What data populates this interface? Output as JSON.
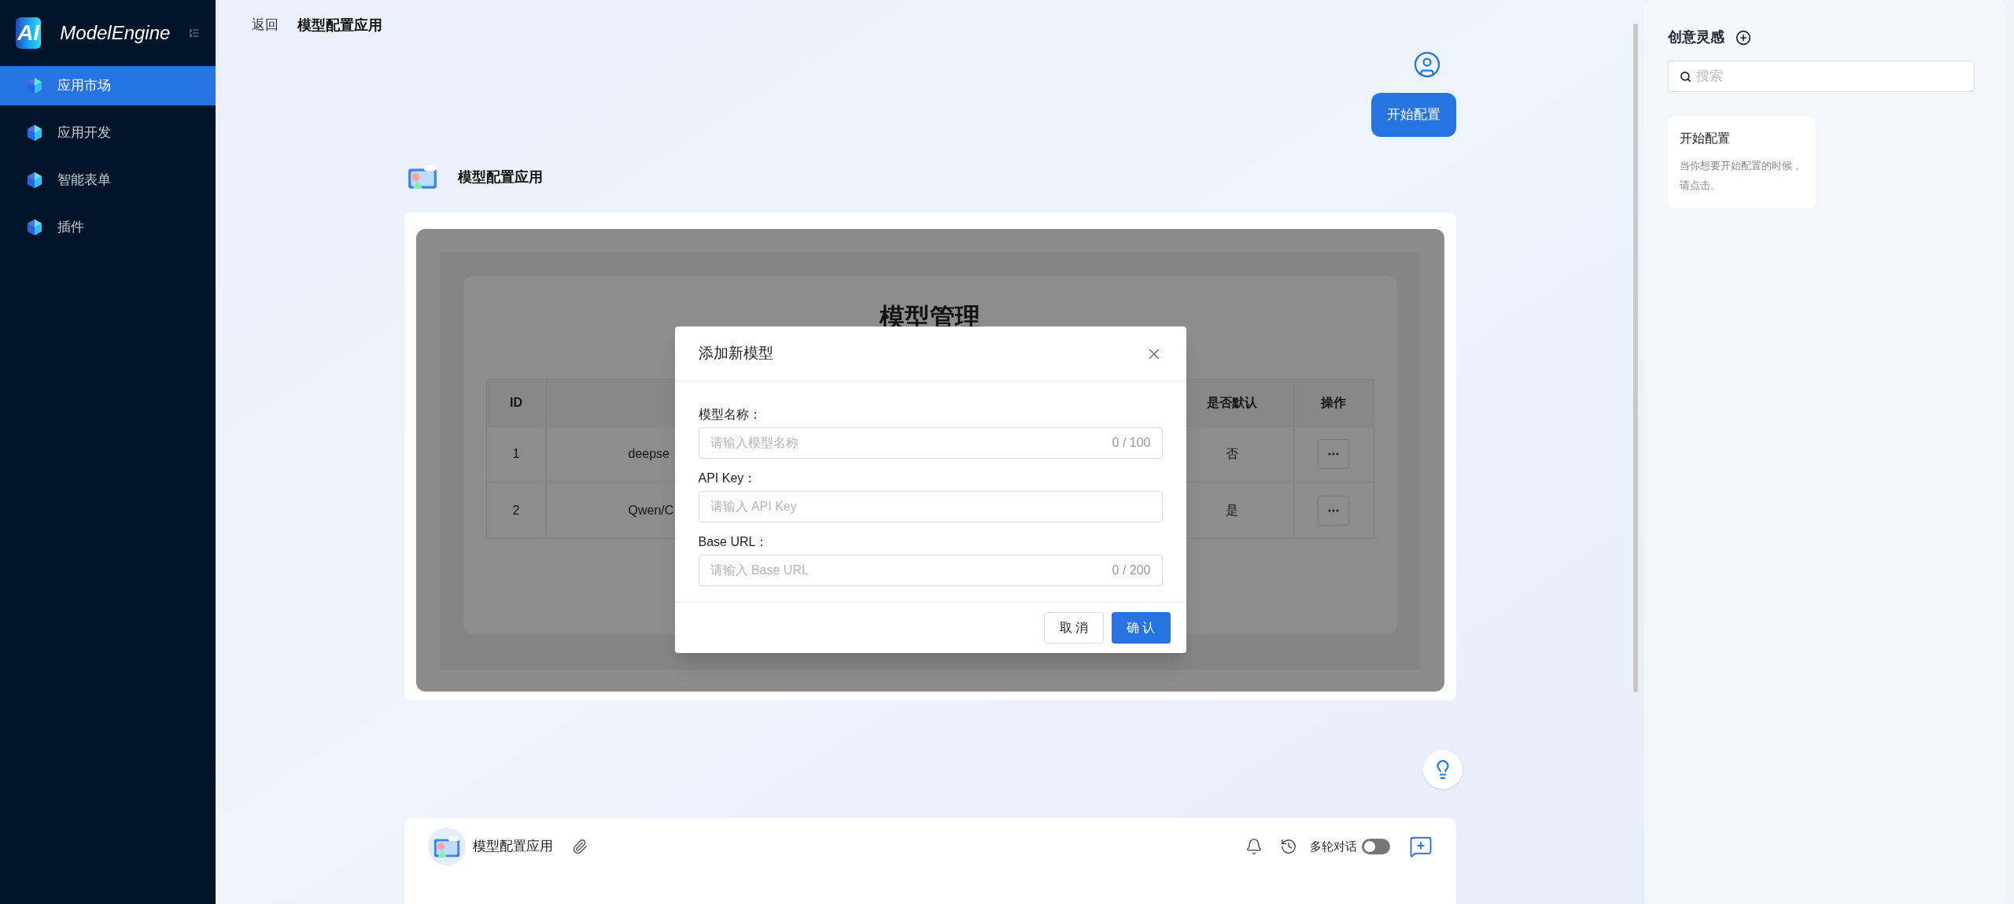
{
  "sidebar": {
    "logo": "AI",
    "brand": "ModelEngine",
    "items": [
      {
        "label": "应用市场",
        "selected": true
      },
      {
        "label": "应用开发",
        "selected": false
      },
      {
        "label": "智能表单",
        "selected": false
      },
      {
        "label": "插件",
        "selected": false
      }
    ]
  },
  "header": {
    "back": "返回",
    "title": "模型配置应用"
  },
  "conversation": {
    "user_message": "开始配置",
    "app_name": "模型配置应用",
    "embedded_app": {
      "title": "模型管理",
      "columns": [
        "ID",
        "是否默认",
        "操作"
      ],
      "rows": [
        {
          "id": "1",
          "name": "deepse",
          "default": "否"
        },
        {
          "id": "2",
          "name": "Qwen/C",
          "default": "是"
        }
      ]
    },
    "dialog": {
      "title": "添加新模型",
      "fields": [
        {
          "label": "模型名称：",
          "placeholder": "请输入模型名称",
          "counter": "0 / 100"
        },
        {
          "label": "API Key：",
          "placeholder": "请输入 API Key"
        },
        {
          "label": "Base URL：",
          "placeholder": "请输入 Base URL",
          "counter": "0 / 200"
        }
      ],
      "cancel": "取 消",
      "confirm": "确 认"
    }
  },
  "composer": {
    "app_name": "模型配置应用",
    "multi_turn": {
      "label": "多轮对话",
      "on": false
    }
  },
  "inspiration": {
    "title": "创意灵感",
    "search": {
      "placeholder": "搜索"
    },
    "cards": [
      {
        "title": "开始配置",
        "description": "当你想要开始配置的时候，请点击。"
      }
    ]
  }
}
